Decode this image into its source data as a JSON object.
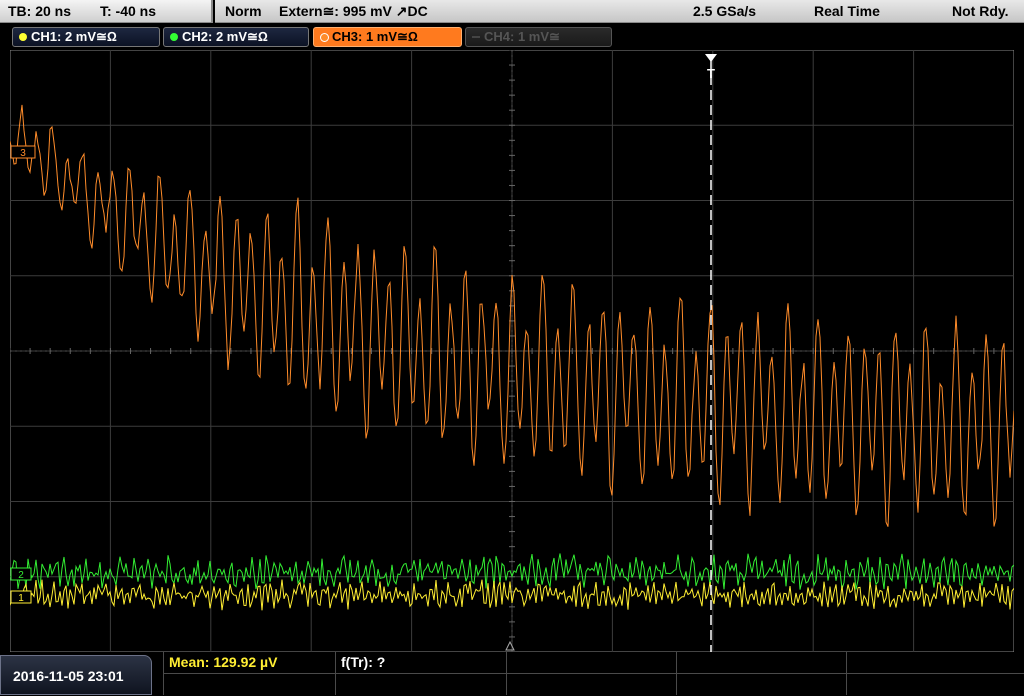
{
  "timebase": {
    "tb": "TB: 20 ns",
    "trigger_pos": "T: -40 ns"
  },
  "status": {
    "mode": "Norm",
    "trigger": "Extern≅: 995 mV ↗DC",
    "sample_rate": "2.5 GSa/s",
    "acq_mode": "Real Time",
    "state": "Not Rdy."
  },
  "channels": [
    {
      "label": "CH1: 2 mV≅Ω",
      "color": "#ffff33",
      "state": "on"
    },
    {
      "label": "CH2: 2 mV≅Ω",
      "color": "#33ff33",
      "state": "on"
    },
    {
      "label": "CH3: 1 mV≅Ω",
      "color": "#ff8c2a",
      "state": "selected"
    },
    {
      "label": "CH4: 1 mV≅",
      "color": "#555555",
      "state": "off"
    }
  ],
  "markers": {
    "trigger": "T",
    "ch3": "3",
    "ch2": "2",
    "ch1": "1"
  },
  "date": "2016-11-05 23:01",
  "measurements": {
    "mean": "Mean: 129.92 µV",
    "freq": "f(Tr): ?"
  },
  "colors": {
    "grid": "#5a5a5a",
    "ch3": "#ff8c2a",
    "ch2": "#33ee33",
    "ch1": "#ffee33"
  }
}
